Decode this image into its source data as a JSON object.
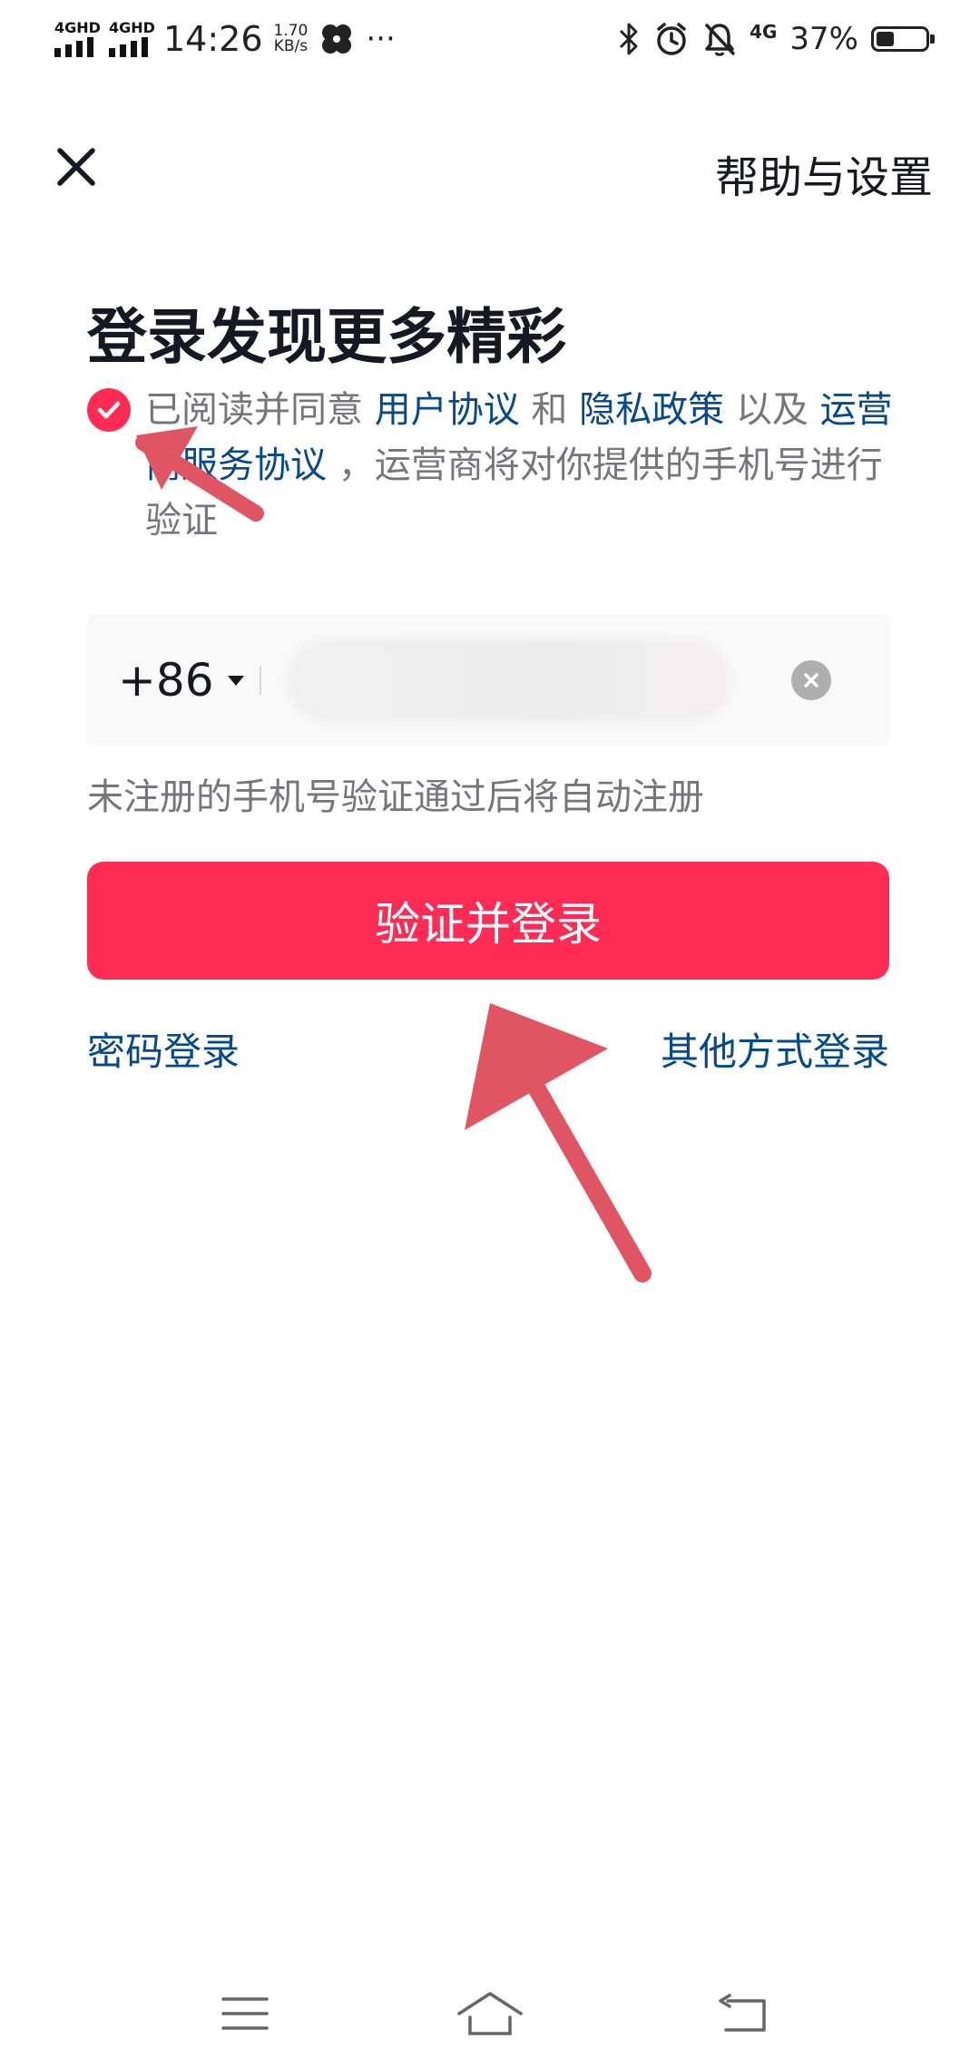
{
  "status_bar": {
    "net1": "4GHD",
    "net2": "4GHD",
    "time": "14:26",
    "speed_value": "1.70",
    "speed_unit": "KB/s",
    "more": "···",
    "network_type": "4G",
    "battery_percent": "37%",
    "battery_level": 0.37,
    "icons": [
      "bluetooth-icon",
      "alarm-icon",
      "mute-bell-icon",
      "battery-icon"
    ]
  },
  "header": {
    "close_icon": "close-icon",
    "help_link": "帮助与设置"
  },
  "title": "登录发现更多精彩",
  "agreement": {
    "checked": true,
    "text_1": "已阅读并同意 ",
    "link_user_agreement": "用户协议",
    "text_2": " 和 ",
    "link_privacy": "隐私政策",
    "text_3": " 以及 ",
    "link_carrier": "运营商服务协议",
    "text_4": " ，运营商将对你提供的手机号进行验证"
  },
  "phone_form": {
    "country_code": "+86",
    "phone_value": ""
  },
  "hint": "未注册的手机号验证通过后将自动注册",
  "login_button": "验证并登录",
  "links": {
    "password_login": "密码登录",
    "other_login": "其他方式登录"
  },
  "colors": {
    "accent": "#fe2c55",
    "link": "#04498d",
    "annotation": "#e05563"
  }
}
